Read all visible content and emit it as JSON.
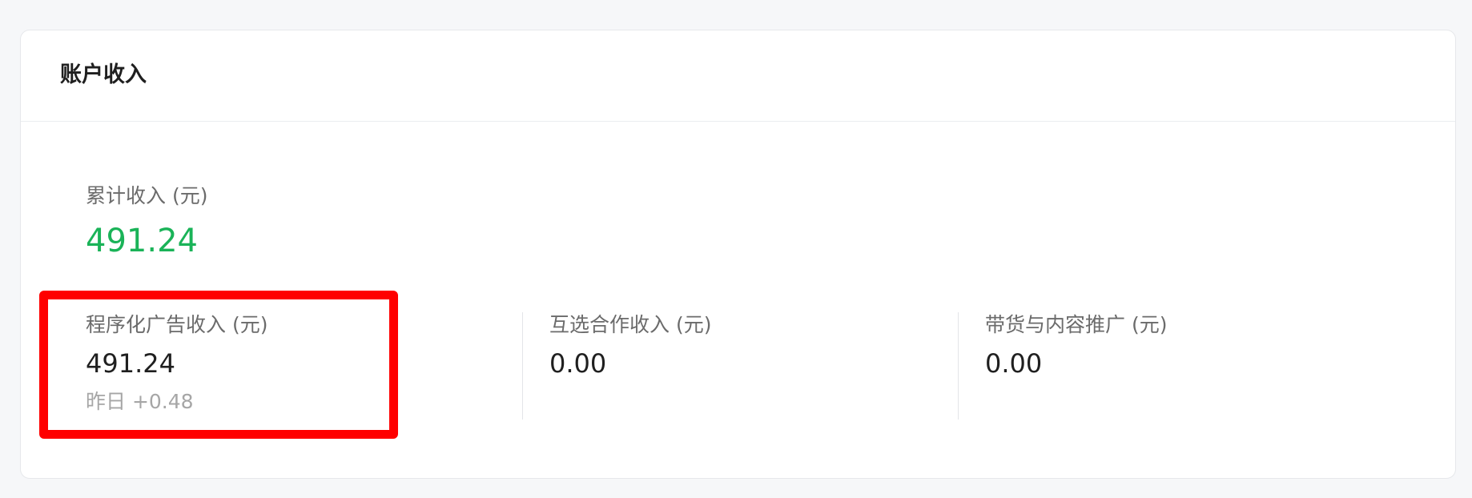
{
  "card": {
    "title": "账户收入"
  },
  "total": {
    "label": "累计收入 (元)",
    "value": "491.24"
  },
  "metrics": [
    {
      "label": "程序化广告收入 (元)",
      "value": "491.24",
      "sub": "昨日 +0.48"
    },
    {
      "label": "互选合作收入 (元)",
      "value": "0.00"
    },
    {
      "label": "带货与内容推广 (元)",
      "value": "0.00"
    }
  ],
  "colors": {
    "total_value": "#1ab358",
    "highlight": "#ff0000"
  }
}
